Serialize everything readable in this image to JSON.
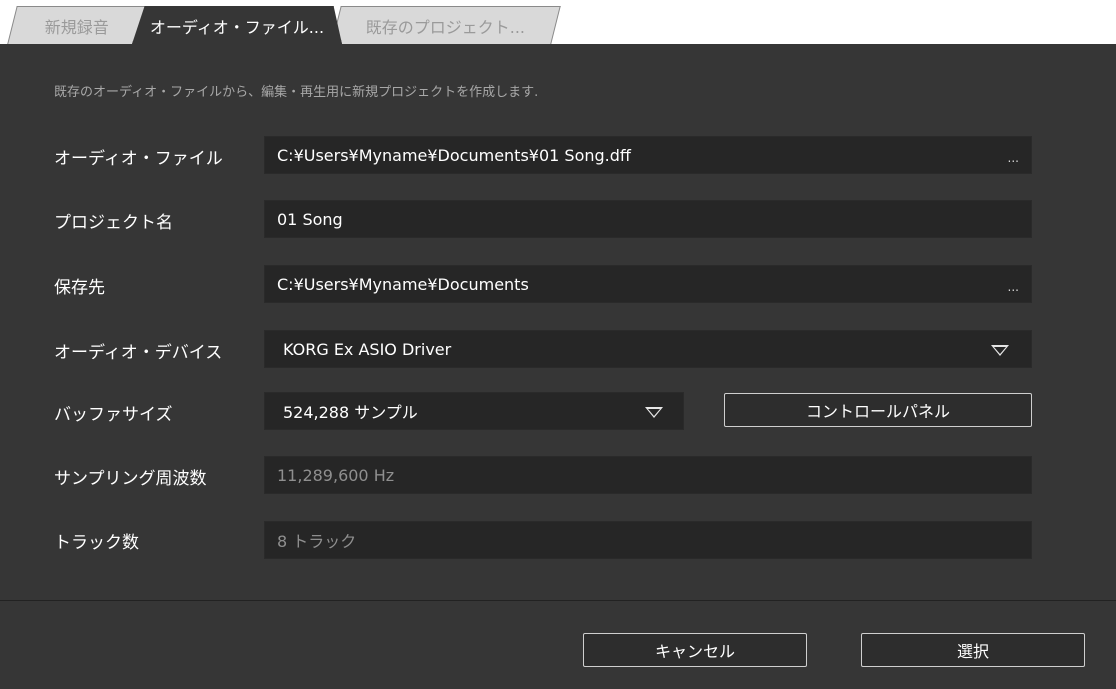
{
  "tabs": [
    {
      "label": "新規録音"
    },
    {
      "label": "オーディオ・ファイル..."
    },
    {
      "label": "既存のプロジェクト..."
    }
  ],
  "description": "既存のオーディオ・ファイルから、編集・再生用に新規プロジェクトを作成します.",
  "form": {
    "audio_file": {
      "label": "オーディオ・ファイル",
      "value": "C:¥Users¥Myname¥Documents¥01 Song.dff",
      "browse": "..."
    },
    "project_name": {
      "label": "プロジェクト名",
      "value": "01 Song"
    },
    "save_to": {
      "label": "保存先",
      "value": "C:¥Users¥Myname¥Documents",
      "browse": "..."
    },
    "audio_device": {
      "label": "オーディオ・デバイス",
      "value": "KORG Ex ASIO Driver"
    },
    "buffer_size": {
      "label": "バッファサイズ",
      "value": "524,288 サンプル"
    },
    "control_panel": "コントロールパネル",
    "sample_rate": {
      "label": "サンプリング周波数",
      "value": "11,289,600 Hz"
    },
    "track_count": {
      "label": "トラック数",
      "value": "8 トラック"
    }
  },
  "footer": {
    "cancel": "キャンセル",
    "select": "選択"
  },
  "icons": {
    "browse": "ellipsis-icon",
    "dropdown": "triangle-down-icon"
  },
  "colors": {
    "background": "#363636",
    "field": "#262626",
    "tabbar": "#ffffff"
  }
}
